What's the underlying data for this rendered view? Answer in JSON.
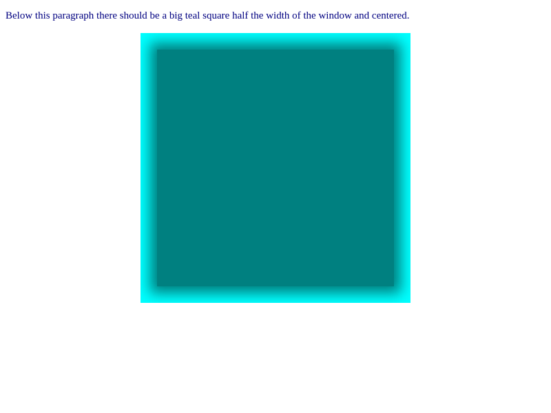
{
  "page": {
    "text": "Below this paragraph there should be a big teal square half the width of the window and centered.",
    "colors": {
      "text": "#000080",
      "border": "#00ffff",
      "fill": "#008080",
      "background": "#ffffff"
    }
  }
}
